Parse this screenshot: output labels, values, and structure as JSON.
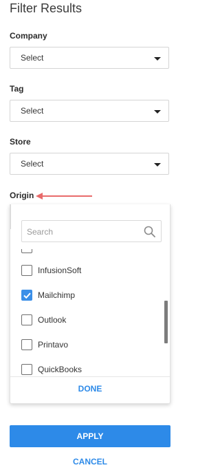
{
  "title": "Filter Results",
  "company": {
    "label": "Company",
    "value": "Select"
  },
  "tag": {
    "label": "Tag",
    "value": "Select"
  },
  "store": {
    "label": "Store",
    "value": "Select"
  },
  "origin": {
    "label": "Origin",
    "search_placeholder": "Search",
    "items": [
      {
        "label": "InfusionSoft",
        "checked": false
      },
      {
        "label": "Mailchimp",
        "checked": true
      },
      {
        "label": "Outlook",
        "checked": false
      },
      {
        "label": "Printavo",
        "checked": false
      },
      {
        "label": "QuickBooks",
        "checked": false
      }
    ],
    "done_label": "DONE"
  },
  "actions": {
    "apply_label": "APPLY",
    "cancel_label": "CANCEL"
  },
  "colors": {
    "accent": "#2d8ae8",
    "annotation_arrow": "#e86a6a"
  },
  "icons": [
    "chevron-down-icon",
    "search-icon",
    "checkmark-icon",
    "arrow-left-icon"
  ]
}
